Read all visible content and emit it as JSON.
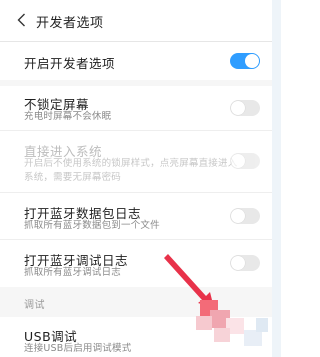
{
  "header": {
    "back_icon": "chevron-left-icon",
    "title": "开发者选项"
  },
  "settings": {
    "dev_options": {
      "title": "开启开发者选项",
      "enabled": true
    },
    "no_lock": {
      "title": "不锁定屏幕",
      "subtitle": "充电时屏幕不会休眠",
      "enabled": false
    },
    "direct_enter": {
      "title": "直接进入系统",
      "subtitle_line1": "开启后不使用系统的锁屏样式，点亮屏幕直接进入",
      "subtitle_line2": "系统，需要无屏幕密码",
      "enabled": false
    },
    "bt_packet_log": {
      "title": "打开蓝牙数据包日志",
      "subtitle": "抓取所有蓝牙数据包到一个文件",
      "enabled": false
    },
    "bt_debug_log": {
      "title": "打开蓝牙调试日志",
      "subtitle": "抓取所有蓝牙调试日志",
      "enabled": false
    }
  },
  "sections": {
    "debug_label": "调试"
  },
  "usb_debug": {
    "title": "USB调试",
    "subtitle": "连接USB后启用调试模式"
  },
  "colors": {
    "accent": "#2f9dff",
    "annotation": "#e8324a"
  }
}
